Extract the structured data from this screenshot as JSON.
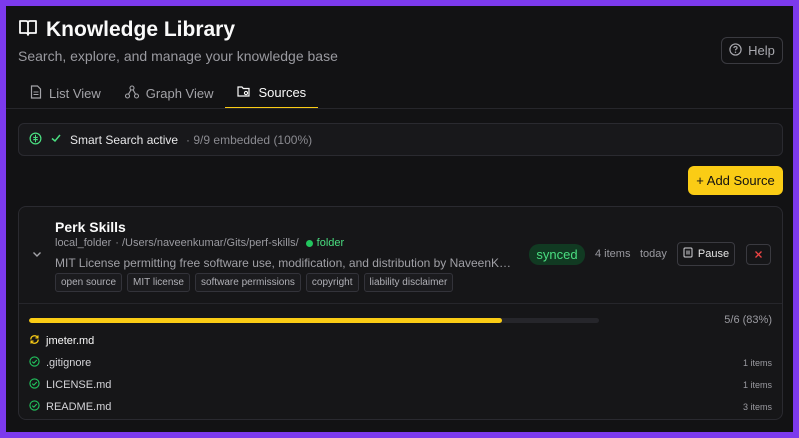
{
  "app": {
    "title": "Knowledge Library",
    "subtitle": "Search, explore, and manage your knowledge base",
    "help_label": "Help"
  },
  "tabs": [
    {
      "label": "List View",
      "icon": "document-icon",
      "active": false
    },
    {
      "label": "Graph View",
      "icon": "graph-icon",
      "active": false
    },
    {
      "label": "Sources",
      "icon": "folder-search-icon",
      "active": true
    }
  ],
  "smart_search": {
    "label": "Smart Search active",
    "count": "· 9/9 embedded (100%)"
  },
  "add_source_label": "+ Add Source",
  "source": {
    "name": "Perk Skills",
    "type": "local_folder",
    "path": "· /Users/naveenkumar/Gits/perf-skills/",
    "kind": "folder",
    "description": "MIT License permitting free software use, modification, and distribution by NaveenKumar...",
    "tags": [
      "open source",
      "MIT license",
      "software permissions",
      "copyright",
      "liability disclaimer"
    ],
    "status": "synced",
    "item_count": "4 items",
    "updated": "today",
    "pause_label": "Pause",
    "progress_label": "5/6 (83%)",
    "progress_fraction": 0.83,
    "files": [
      {
        "name": "jmeter.md",
        "state": "syncing",
        "count": ""
      },
      {
        "name": ".gitignore",
        "state": "done",
        "count": "1 items"
      },
      {
        "name": "LICENSE.md",
        "state": "done",
        "count": "1 items"
      },
      {
        "name": "README.md",
        "state": "done",
        "count": "3 items"
      }
    ]
  },
  "colors": {
    "accent": "#facc15",
    "success": "#22c55e",
    "frame": "#7c3aed",
    "background": "#121214",
    "danger": "#ef4444"
  }
}
